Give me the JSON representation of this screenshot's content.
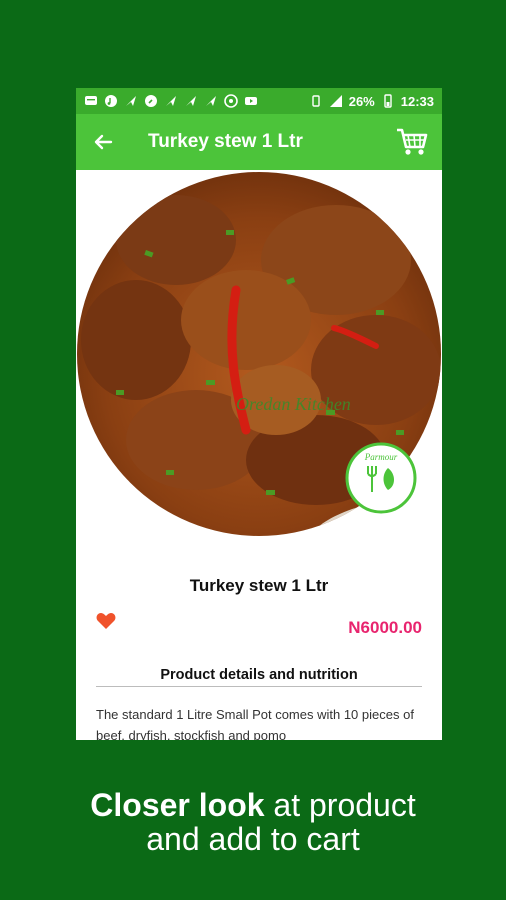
{
  "statusbar": {
    "battery_percent": "26%",
    "time": "12:33"
  },
  "appbar": {
    "title": "Turkey stew 1 Ltr"
  },
  "product": {
    "image_watermark": "Oredan Kitchen",
    "badge_text": "Parmour",
    "name": "Turkey stew 1 Ltr",
    "price": "N6000.00",
    "details_heading": "Product details and nutrition",
    "description": "The standard 1 Litre Small Pot comes with 10 pieces of beef, dryfish, stockfish and pomo"
  },
  "caption": {
    "bold": "Closer look",
    "rest_line1": " at product",
    "line2": "and add to cart"
  },
  "colors": {
    "page_bg": "#0b6a16",
    "appbar": "#4cc43a",
    "statusbar": "#3aab2c",
    "price": "#e8246e",
    "heart": "#f0522b"
  }
}
